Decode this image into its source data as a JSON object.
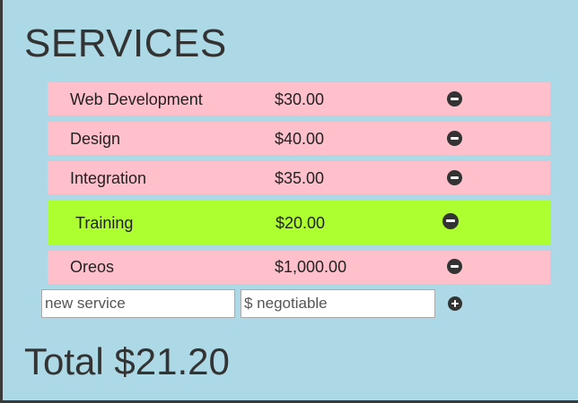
{
  "title": "SERVICES",
  "services": [
    {
      "name": "Web Development",
      "price": "$30.00"
    },
    {
      "name": "Design",
      "price": "$40.00"
    },
    {
      "name": "Integration",
      "price": "$35.00"
    },
    {
      "name": "Training",
      "price": "$20.00",
      "selected": true
    },
    {
      "name": "Oreos",
      "price": "$1,000.00"
    }
  ],
  "new_service": {
    "name_placeholder": "new service",
    "price_placeholder": "$ negotiable",
    "name_value": "",
    "price_value": ""
  },
  "total": {
    "label": "Total",
    "value": "$21.20"
  },
  "colors": {
    "background": "#add8e6",
    "row": "#ffc0cb",
    "row_selected": "#adff2f",
    "icon": "#333333"
  },
  "icons": {
    "remove": "minus-circle-icon",
    "add": "plus-circle-icon"
  }
}
